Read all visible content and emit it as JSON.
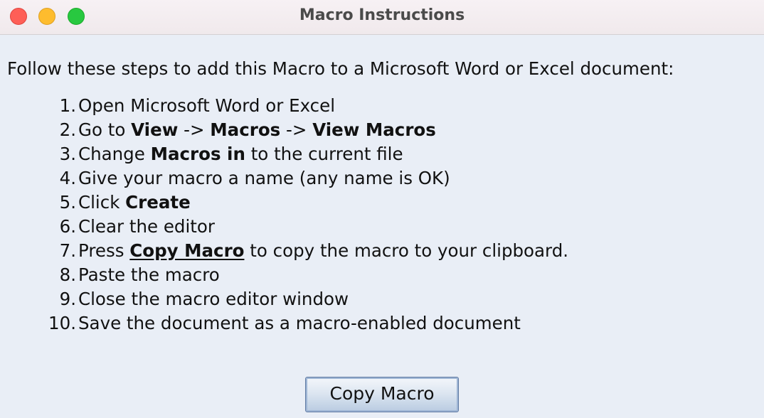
{
  "window": {
    "title": "Macro Instructions",
    "controls": [
      "close",
      "minimize",
      "maximize"
    ]
  },
  "intro": "Follow these steps to add this Macro to a Microsoft Word or Excel document:",
  "steps": [
    {
      "num": "1.",
      "parts": [
        {
          "text": "Open Microsoft Word or Excel"
        }
      ]
    },
    {
      "num": "2.",
      "parts": [
        {
          "text": "Go to "
        },
        {
          "text": "View",
          "bold": true
        },
        {
          "text": " -> "
        },
        {
          "text": "Macros",
          "bold": true
        },
        {
          "text": " -> "
        },
        {
          "text": "View Macros",
          "bold": true
        }
      ]
    },
    {
      "num": "3.",
      "parts": [
        {
          "text": "Change "
        },
        {
          "text": "Macros in",
          "bold": true
        },
        {
          "text": " to the current file"
        }
      ]
    },
    {
      "num": "4.",
      "parts": [
        {
          "text": "Give your macro a name (any name is OK)"
        }
      ]
    },
    {
      "num": "5.",
      "parts": [
        {
          "text": "Click "
        },
        {
          "text": "Create",
          "bold": true
        }
      ]
    },
    {
      "num": "6.",
      "parts": [
        {
          "text": "Clear the editor"
        }
      ]
    },
    {
      "num": "7.",
      "parts": [
        {
          "text": "Press "
        },
        {
          "text": "Copy Macro",
          "bold": true,
          "underline": true
        },
        {
          "text": " to copy the macro to your clipboard."
        }
      ]
    },
    {
      "num": "8.",
      "parts": [
        {
          "text": "Paste the macro"
        }
      ]
    },
    {
      "num": "9.",
      "parts": [
        {
          "text": "Close the macro editor window"
        }
      ]
    },
    {
      "num": "10.",
      "parts": [
        {
          "text": "Save the document as a macro-enabled document"
        }
      ]
    }
  ],
  "button": {
    "label": "Copy Macro"
  },
  "colors": {
    "background": "#e9eef6",
    "close": "#fe5f57",
    "minimize": "#febc2e",
    "maximize": "#28c840",
    "button_border": "#5f7aa3"
  }
}
